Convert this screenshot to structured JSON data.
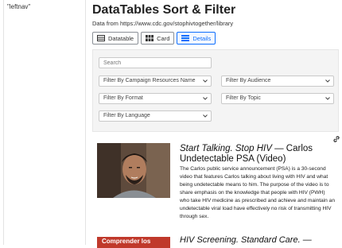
{
  "leftnav": {
    "label": "\"leftnav\""
  },
  "header": {
    "title": "DataTables Sort & Filter",
    "source": "Data from https://www.cdc.gov/stophivtogether/library"
  },
  "views": [
    {
      "label": "Datatable",
      "icon": "table-icon"
    },
    {
      "label": "Card",
      "icon": "grid-icon"
    },
    {
      "label": "Details",
      "icon": "list-icon",
      "active": true
    }
  ],
  "filters": {
    "search_placeholder": "Search",
    "campaign": "Filter By Campaign Resources Name",
    "audience": "Filter By Audience",
    "format": "Filter By Format",
    "topic": "Filter By Topic",
    "language": "Filter By Language"
  },
  "items": [
    {
      "title_italic": "Start Talking. Stop HIV",
      "title_rest": " — Carlos Undetectable PSA (Video)",
      "description": "The Carlos public service announcement (PSA) is a 30-second video that features Carlos talking about living with HIV and what being undetectable means to him. The purpose of the video is to share emphasis on the knowledge that people with HIV (PWH) who take HIV medicine as prescribed and achieve and maintain an undetectable viral load have effectively no risk of transmitting HIV through sex."
    },
    {
      "title_italic": "HIV Screening. Standard Care. —",
      "thumb_text": "Comprender los"
    }
  ],
  "colors": {
    "accent": "#0d6efd",
    "panel": "#f4f4f4"
  }
}
